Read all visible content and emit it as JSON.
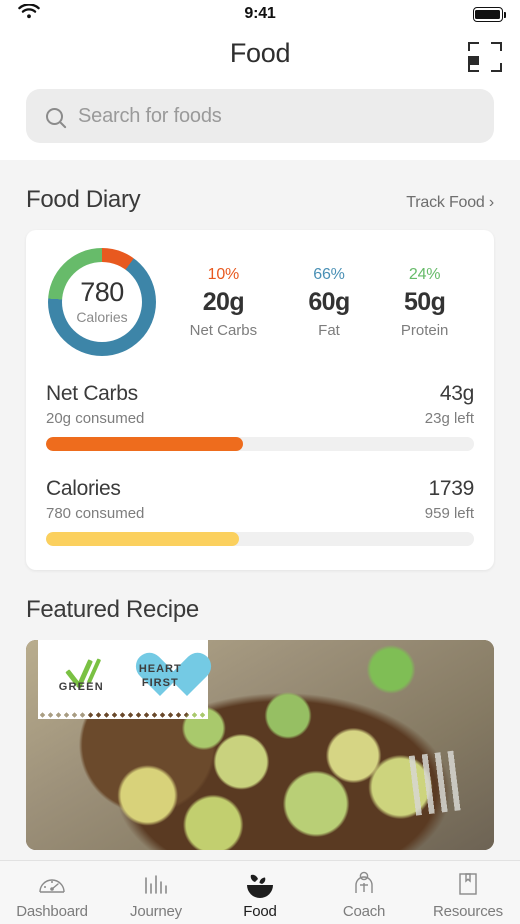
{
  "status_bar": {
    "time": "9:41",
    "wifi_icon": "wifi-icon",
    "battery_icon": "battery-full-icon"
  },
  "header": {
    "title": "Food",
    "scan_icon": "barcode-scan-icon"
  },
  "search": {
    "placeholder": "Search for foods",
    "value": "",
    "icon": "search-icon"
  },
  "food_diary": {
    "section_title": "Food Diary",
    "track_link": "Track Food ›",
    "calories_value": "780",
    "calories_label": "Calories",
    "macros": [
      {
        "percent": "10%",
        "value": "20g",
        "label": "Net Carbs",
        "color": "#e8591f"
      },
      {
        "percent": "66%",
        "value": "60g",
        "label": "Fat",
        "color": "#4a90b5"
      },
      {
        "percent": "24%",
        "value": "50g",
        "label": "Protein",
        "color": "#67bb6a"
      }
    ],
    "progress": [
      {
        "name": "Net Carbs",
        "total": "43g",
        "consumed": "20g consumed",
        "left": "23g left",
        "fill_percent": 46,
        "color": "#ee6c1d"
      },
      {
        "name": "Calories",
        "total": "1739",
        "consumed": "780 consumed",
        "left": "959 left",
        "fill_percent": 45,
        "color": "#fbd05e"
      }
    ]
  },
  "featured_recipe": {
    "section_title": "Featured Recipe",
    "image_description": "Roasted brussels sprouts in a dark wooden bowl on burlap with a fork",
    "badges": [
      {
        "icon": "green-check-icon",
        "label": "GREEN"
      },
      {
        "icon": "heart-icon",
        "line1": "HEART",
        "line2": "FIRST"
      }
    ]
  },
  "chart_data": {
    "type": "pie",
    "title": "Calorie macro breakdown",
    "categories": [
      "Net Carbs",
      "Fat",
      "Protein"
    ],
    "values": [
      10,
      66,
      24
    ],
    "grams": [
      20,
      60,
      50
    ],
    "colors": [
      "#e8591f",
      "#3d85a8",
      "#67bb6a"
    ],
    "center_value": 780,
    "center_label": "Calories",
    "start_angle_deg": 0,
    "legend": "right"
  },
  "tabbar": {
    "items": [
      {
        "label": "Dashboard",
        "icon": "gauge-icon",
        "active": false
      },
      {
        "label": "Journey",
        "icon": "bars-icon",
        "active": false
      },
      {
        "label": "Food",
        "icon": "food-bowl-icon",
        "active": true
      },
      {
        "label": "Coach",
        "icon": "person-icon",
        "active": false
      },
      {
        "label": "Resources",
        "icon": "bookmark-icon",
        "active": false
      }
    ]
  }
}
